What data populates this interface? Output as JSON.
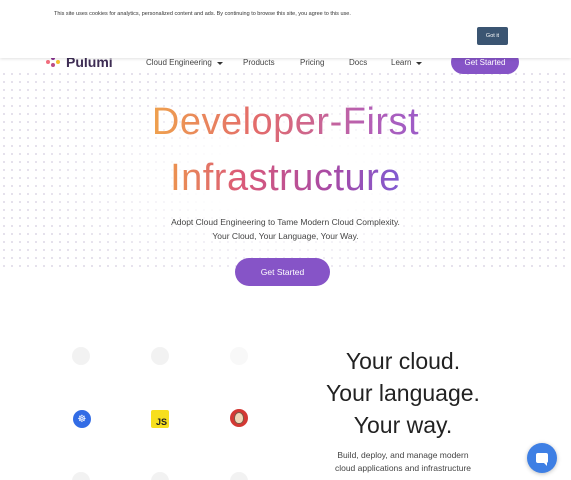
{
  "cookie_banner": {
    "text": "This site uses cookies for analytics, personalized content and ads. By continuing to browse this site, you agree to this use.",
    "button_label": "Got it"
  },
  "navbar": {
    "logo_text": "Pulumi",
    "items": [
      {
        "label": "Cloud Engineering",
        "has_dropdown": true
      },
      {
        "label": "Products",
        "has_dropdown": false
      },
      {
        "label": "Pricing",
        "has_dropdown": false
      },
      {
        "label": "Docs",
        "has_dropdown": false
      },
      {
        "label": "Learn",
        "has_dropdown": true
      }
    ],
    "cta_label": "Get Started"
  },
  "hero": {
    "title_line1": "Developer-First",
    "title_line2": "Infrastructure",
    "subtitle_line1": "Adopt Cloud Engineering to Tame Modern Cloud Complexity.",
    "subtitle_line2": "Your Cloud, Your Language, Your Way.",
    "cta_label": "Get Started"
  },
  "icon_grid": {
    "visible_icons": [
      {
        "icon": "kubernetes-icon"
      },
      {
        "icon": "javascript-icon",
        "label": "JS"
      },
      {
        "icon": "jenkins-icon"
      }
    ]
  },
  "tagline": {
    "line1": "Your cloud.",
    "line2": "Your language.",
    "line3": "Your way.",
    "desc_line1": "Build, deploy, and manage modern",
    "desc_line2": "cloud applications and infrastructure"
  },
  "colors": {
    "accent": "#8654c7",
    "cookie_button": "#3b5572",
    "chat": "#3e7fe4"
  }
}
